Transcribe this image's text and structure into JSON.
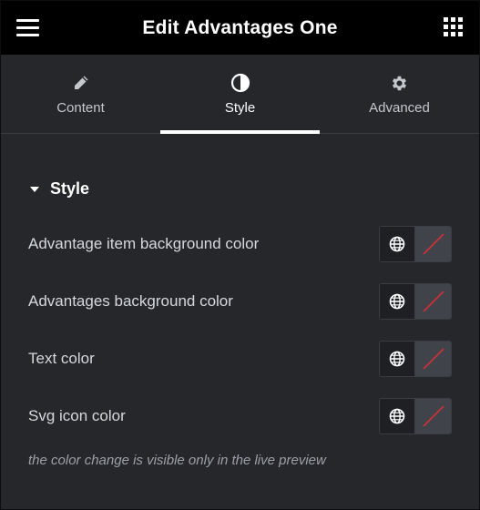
{
  "header": {
    "title": "Edit Advantages One",
    "menu_icon": "hamburger-icon",
    "apps_icon": "grid-icon"
  },
  "tabs": [
    {
      "label": "Content",
      "icon": "pencil-icon",
      "active": false
    },
    {
      "label": "Style",
      "icon": "half-circle-icon",
      "active": true
    },
    {
      "label": "Advanced",
      "icon": "gear-icon",
      "active": false
    }
  ],
  "section": {
    "title": "Style",
    "expanded": true
  },
  "controls": [
    {
      "label": "Advantage item background color"
    },
    {
      "label": "Advantages background color"
    },
    {
      "label": "Text color"
    },
    {
      "label": "Svg icon color"
    }
  ],
  "help_text": "the color change is visible only in the live preview",
  "colors": {
    "header_bg": "#000000",
    "panel_bg": "#26272b",
    "active_underline": "#ffffff",
    "swatch_slash": "#d0323a"
  }
}
